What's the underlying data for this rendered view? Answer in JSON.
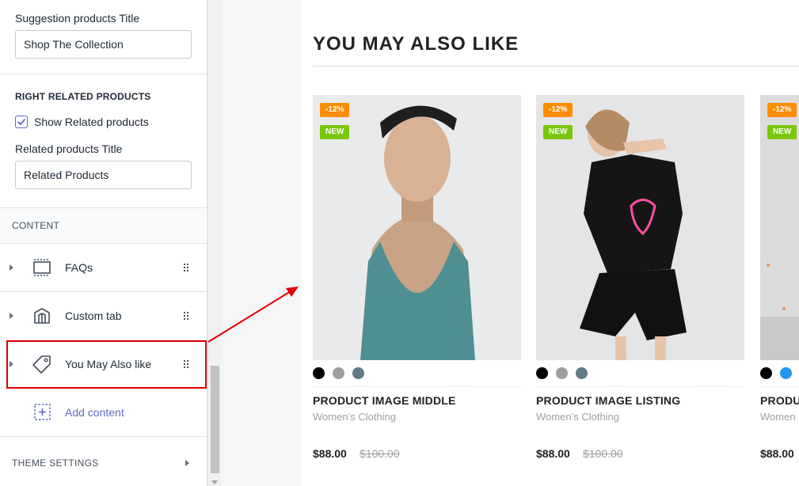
{
  "sidebar": {
    "suggestion": {
      "label": "Suggestion products Title",
      "value": "Shop The Collection"
    },
    "right_related": {
      "heading": "RIGHT RELATED PRODUCTS",
      "checkbox_label": "Show Related products",
      "checked": true,
      "title_label": "Related products Title",
      "title_value": "Related Products"
    },
    "content_header": "CONTENT",
    "blocks": [
      {
        "label": "FAQs",
        "icon": "faq-block-icon"
      },
      {
        "label": "Custom tab",
        "icon": "book-icon"
      },
      {
        "label": "You May Also like",
        "icon": "tag-icon"
      }
    ],
    "add_content": "Add content",
    "theme_settings": "THEME SETTINGS"
  },
  "preview": {
    "title": "YOU MAY ALSO LIKE",
    "products": [
      {
        "sale_badge": "-12%",
        "new_badge": "NEW",
        "swatches": [
          "#000000",
          "#9e9e9e",
          "#5f7a87"
        ],
        "name": "PRODUCT IMAGE MIDDLE",
        "category": "Women’s Clothing",
        "price": "$88.00",
        "old_price": "$100.00"
      },
      {
        "sale_badge": "-12%",
        "new_badge": "NEW",
        "swatches": [
          "#000000",
          "#9e9e9e",
          "#5f7a87"
        ],
        "name": "PRODUCT IMAGE LISTING",
        "category": "Women’s Clothing",
        "price": "$88.00",
        "old_price": "$100.00"
      },
      {
        "sale_badge": "-12%",
        "new_badge": "NEW",
        "swatches": [
          "#000000",
          "#2196f3"
        ],
        "name": "PRODU",
        "category": "Women",
        "price": "$88.00",
        "old_price": ""
      }
    ]
  },
  "colors": {
    "accent": "#5c6ac4",
    "highlight": "#e30000",
    "sale_badge": "#ff8c00",
    "new_badge": "#7ac70c"
  }
}
